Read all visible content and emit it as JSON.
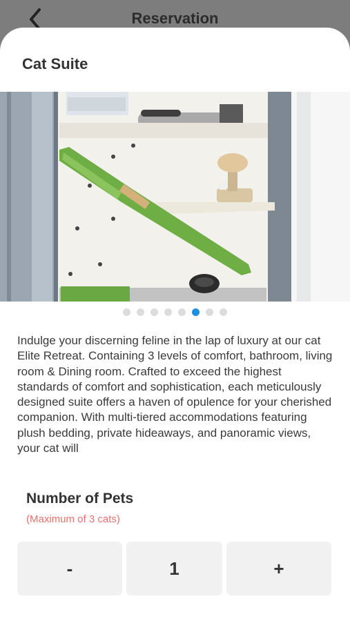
{
  "header": {
    "title": "Reservation",
    "back_icon": "chevron-left-icon"
  },
  "sheet": {
    "title": "Cat Suite",
    "gallery": {
      "slide_count": 8,
      "active_index": 5
    },
    "description": "Indulge your discerning feline in the lap of luxury at our cat Elite Retreat. Containing 3 levels of comfort, bathroom, living room & Dining room. Crafted to exceed the highest standards of comfort and sophistication, each meticulously designed suite offers a haven of opulence for your cherished companion. With multi-tiered accommodations featuring plush bedding, private hideaways, and panoramic views, your cat will",
    "pets": {
      "label": "Number of Pets",
      "max_note": "(Maximum of 3 cats)",
      "decrement_label": "-",
      "value": "1",
      "increment_label": "+"
    }
  },
  "colors": {
    "accent": "#1e8fe0",
    "warning": "#ee6e6e",
    "backdrop": "#7d7d7d"
  }
}
